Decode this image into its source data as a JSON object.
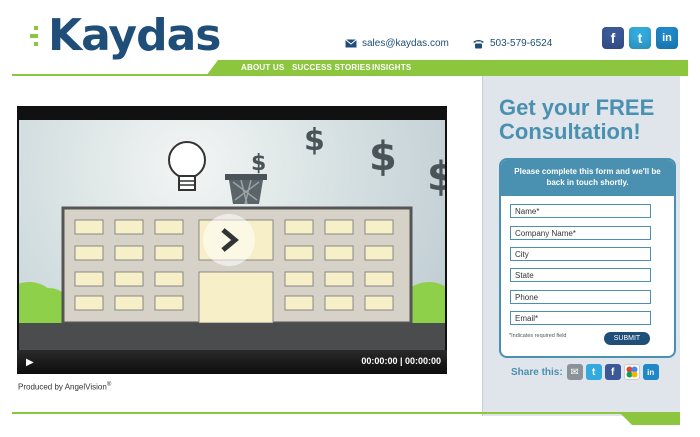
{
  "brand": {
    "name": "Kaydas",
    "accent": "#8cc63f",
    "primary": "#1f4e79",
    "secondary": "#4a90b0"
  },
  "contact": {
    "email": "sales@kaydas.com",
    "phone": "503-579-6524"
  },
  "social": [
    {
      "name": "facebook",
      "glyph": "f",
      "color": "#3b5998"
    },
    {
      "name": "twitter",
      "glyph": "t",
      "color": "#33aadd"
    },
    {
      "name": "linkedin",
      "glyph": "in",
      "color": "#1e88c9"
    }
  ],
  "nav": [
    "ABOUT US",
    "SUCCESS STORIES",
    "INSIGHTS"
  ],
  "video": {
    "time": "00:00:00 | 00:00:00",
    "produced_by": "Produced by AngelVision",
    "produced_mark": "®"
  },
  "panel": {
    "cta": "Get your FREE Consultation!",
    "form_intro": "Please complete this form and we'll be back in touch shortly.",
    "fields": [
      "Name*",
      "Company Name*",
      "City",
      "State",
      "Phone",
      "Email*"
    ],
    "required_note": "*Indicates required field",
    "submit": "SUBMIT",
    "share_label": "Share this:"
  }
}
